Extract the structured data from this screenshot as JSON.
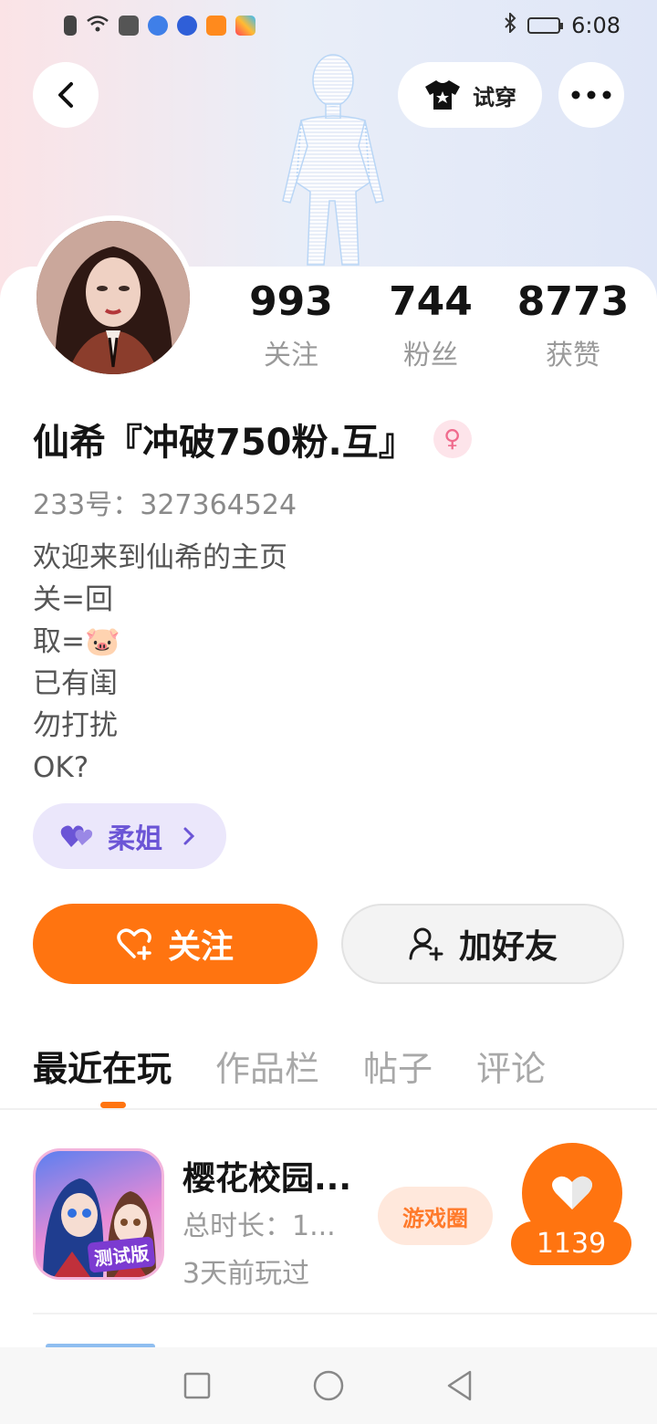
{
  "status_bar": {
    "time": "6:08"
  },
  "header": {
    "try_on_label": "试穿"
  },
  "stats": [
    {
      "value": "993",
      "label": "关注"
    },
    {
      "value": "744",
      "label": "粉丝"
    },
    {
      "value": "8773",
      "label": "获赞"
    }
  ],
  "profile": {
    "nickname": "仙希『冲破750粉.互』",
    "gender_symbol": "♀",
    "account_id": "233号：327364524",
    "bio_lines": [
      "欢迎来到仙希的主页",
      "关=回",
      "取=🐷",
      "已有闺",
      "勿打扰",
      "OK?"
    ],
    "tag_label": "柔姐"
  },
  "actions": {
    "follow_label": "关注",
    "add_friend_label": "加好友"
  },
  "tabs": [
    {
      "label": "最近在玩",
      "active": true
    },
    {
      "label": "作品栏",
      "active": false
    },
    {
      "label": "帖子",
      "active": false
    },
    {
      "label": "评论",
      "active": false
    }
  ],
  "games": [
    {
      "title": "樱花校园...",
      "duration": "总时长：1...",
      "last_played": "3天前玩过",
      "icon_badge": "测试版",
      "circle_label": "游戏圈",
      "like_count": "1139"
    }
  ],
  "colors": {
    "accent": "#ff7410",
    "tag_purple": "#6b55d6",
    "gender_pink": "#f06b8d"
  },
  "icons": {
    "back": "chevron-left-icon",
    "try_on": "tshirt-icon",
    "more": "more-dots-icon",
    "heart": "heart-icon",
    "add_friend": "user-plus-icon"
  }
}
